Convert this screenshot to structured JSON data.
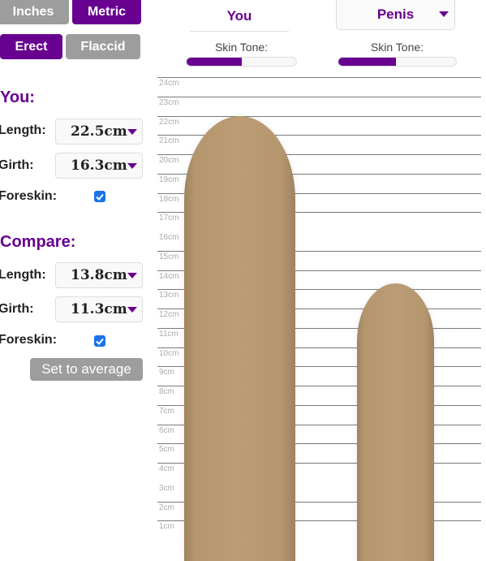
{
  "units": {
    "inches_label": "Inches",
    "metric_label": "Metric",
    "selected": "Metric"
  },
  "state": {
    "erect_label": "Erect",
    "flaccid_label": "Flaccid",
    "selected": "Erect"
  },
  "columns": {
    "you": {
      "title": "You",
      "skin_tone_label": "Skin Tone:",
      "skin_tone_value": 0.5
    },
    "compare": {
      "title": "Penis",
      "skin_tone_label": "Skin Tone:",
      "skin_tone_value": 0.49
    }
  },
  "you": {
    "section_title": "You:",
    "length_label": "Length:",
    "length_value": "22.5cm",
    "girth_label": "Girth:",
    "girth_value": "16.3cm",
    "foreskin_label": "Foreskin:",
    "foreskin_checked": true
  },
  "compare": {
    "section_title": "Compare:",
    "length_label": "Length:",
    "length_value": "13.8cm",
    "girth_label": "Girth:",
    "girth_value": "11.3cm",
    "foreskin_label": "Foreskin:",
    "foreskin_checked": true,
    "average_button": "Set to average"
  },
  "chart_data": {
    "type": "bar",
    "categories": [
      "You",
      "Compare"
    ],
    "values": [
      22.5,
      13.8
    ],
    "girths": [
      16.3,
      11.3
    ],
    "ylabel": "cm",
    "ticks": [
      "24cm",
      "23cm",
      "22cm",
      "21cm",
      "20cm",
      "19cm",
      "18cm",
      "17cm",
      "16cm",
      "15cm",
      "14cm",
      "13cm",
      "12cm",
      "11cm",
      "10cm",
      "9cm",
      "8cm",
      "7cm",
      "6cm",
      "5cm",
      "4cm",
      "3cm",
      "2cm",
      "1cm"
    ],
    "ylim": [
      0,
      24.5
    ],
    "grid": true
  }
}
